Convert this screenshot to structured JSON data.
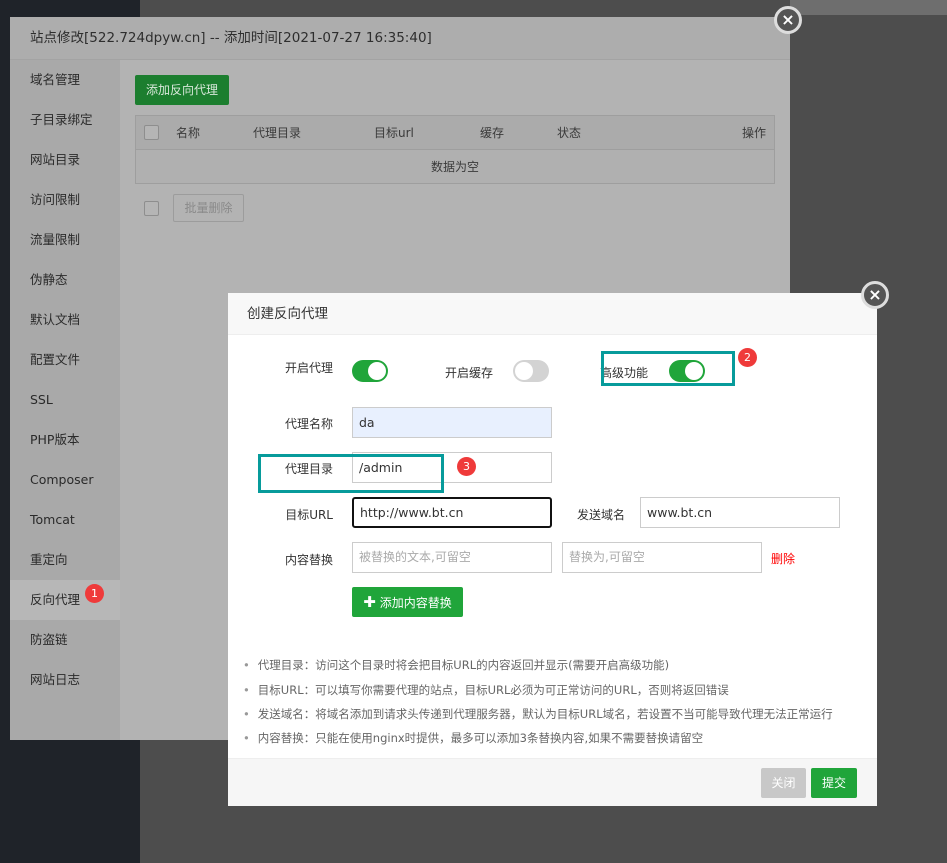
{
  "outer": {
    "title": "站点修改[522.724dpyw.cn] -- 添加时间[2021-07-27 16:35:40]",
    "sidebar": [
      "域名管理",
      "子目录绑定",
      "网站目录",
      "访问限制",
      "流量限制",
      "伪静态",
      "默认文档",
      "配置文件",
      "SSL",
      "PHP版本",
      "Composer",
      "Tomcat",
      "重定向",
      "反向代理",
      "防盗链",
      "网站日志"
    ],
    "active_item": "反向代理",
    "add_button": "添加反向代理",
    "table": {
      "headers": [
        "名称",
        "代理目录",
        "目标url",
        "缓存",
        "状态",
        "操作"
      ],
      "empty": "数据为空"
    },
    "batch_delete": "批量删除"
  },
  "dialog": {
    "title": "创建反向代理",
    "enable_proxy": {
      "label": "开启代理",
      "on": true
    },
    "enable_cache": {
      "label": "开启缓存",
      "on": false
    },
    "advanced": {
      "label": "高级功能",
      "on": true
    },
    "proxy_name": {
      "label": "代理名称",
      "value": "da"
    },
    "proxy_dir": {
      "label": "代理目录",
      "value": "/admin"
    },
    "target_url": {
      "label": "目标URL",
      "value": "http://www.bt.cn"
    },
    "send_domain": {
      "label": "发送域名",
      "value": "www.bt.cn"
    },
    "replace": {
      "label": "内容替换",
      "from_placeholder": "被替换的文本,可留空",
      "to_placeholder": "替换为,可留空",
      "delete": "删除"
    },
    "add_replace": "添加内容替换",
    "tips": [
      "代理目录：访问这个目录时将会把目标URL的内容返回并显示(需要开启高级功能)",
      "目标URL：可以填写你需要代理的站点，目标URL必须为可正常访问的URL，否则将返回错误",
      "发送域名：将域名添加到请求头传递到代理服务器，默认为目标URL域名，若设置不当可能导致代理无法正常运行",
      "内容替换：只能在使用nginx时提供，最多可以添加3条替换内容,如果不需要替换请留空"
    ],
    "close": "关闭",
    "submit": "提交"
  },
  "badges": [
    "1",
    "2",
    "3"
  ],
  "colors": {
    "green": "#20a53a",
    "teal": "#079b9b",
    "badge": "#ef3a3a",
    "delete": "#ff0000"
  }
}
